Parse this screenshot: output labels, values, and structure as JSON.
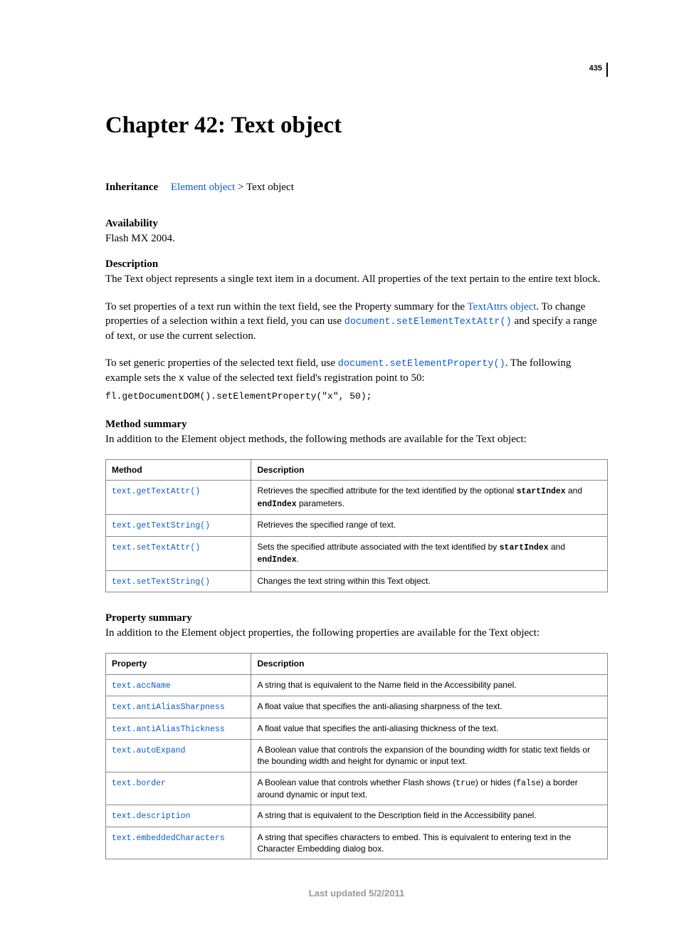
{
  "pageNumber": "435",
  "chapterTitle": "Chapter 42: Text object",
  "inheritance": {
    "label": "Inheritance",
    "link": "Element object",
    "sep": " > ",
    "current": "Text object"
  },
  "availability": {
    "head": "Availability",
    "body": "Flash MX 2004."
  },
  "description": {
    "head": "Description",
    "p1": "The Text object represents a single text item in a document. All properties of the text pertain to the entire text block.",
    "p2a": "To set properties of a text run within the text field, see the Property summary for the ",
    "p2link": "TextAttrs object",
    "p2b": ". To change properties of a selection within a text field, you can use ",
    "p2code": "document.setElementTextAttr()",
    "p2c": " and specify a range of text, or use the current selection.",
    "p3a": "To set generic properties of the selected text field, use ",
    "p3code": "document.setElementProperty()",
    "p3b": ". The following example sets the ",
    "p3x": "x",
    "p3c": " value of the selected text field's registration point to 50:",
    "codeBlock": "fl.getDocumentDOM().setElementProperty(\"x\", 50);"
  },
  "methodSummary": {
    "head": "Method summary",
    "intro": "In addition to the Element object methods, the following methods are available for the Text object:",
    "colMethod": "Method",
    "colDesc": "Description",
    "rows": [
      {
        "name": "text.getTextAttr()",
        "descA": "Retrieves the specified attribute for the text identified by the optional ",
        "c1": "startIndex",
        "descB": " and ",
        "c2": "endIndex",
        "descC": " parameters."
      },
      {
        "name": "text.getTextString()",
        "descA": "Retrieves the specified range of text.",
        "c1": "",
        "descB": "",
        "c2": "",
        "descC": ""
      },
      {
        "name": "text.setTextAttr()",
        "descA": "Sets the specified attribute associated with the text identified by ",
        "c1": "startIndex",
        "descB": " and ",
        "c2": "endIndex",
        "descC": "."
      },
      {
        "name": "text.setTextString()",
        "descA": "Changes the text string within this Text object.",
        "c1": "",
        "descB": "",
        "c2": "",
        "descC": ""
      }
    ]
  },
  "propertySummary": {
    "head": "Property summary",
    "intro": "In addition to the Element object properties, the following properties are available for the Text object:",
    "colProp": "Property",
    "colDesc": "Description",
    "rows": [
      {
        "name": "text.accName",
        "descA": "A string that is equivalent to the Name field in the Accessibility panel.",
        "c1": "",
        "descB": "",
        "c2": "",
        "descC": ""
      },
      {
        "name": "text.antiAliasSharpness",
        "descA": "A float value that specifies the anti-aliasing sharpness of the text.",
        "c1": "",
        "descB": "",
        "c2": "",
        "descC": ""
      },
      {
        "name": "text.antiAliasThickness",
        "descA": "A float value that specifies the anti-aliasing thickness of the text.",
        "c1": "",
        "descB": "",
        "c2": "",
        "descC": ""
      },
      {
        "name": "text.autoExpand",
        "descA": "A Boolean value that controls the expansion of the bounding width for static text fields or the bounding width and height for dynamic or input text.",
        "c1": "",
        "descB": "",
        "c2": "",
        "descC": ""
      },
      {
        "name": "text.border",
        "descA": "A Boolean value that controls whether Flash shows (",
        "c1": "true",
        "descB": ") or hides (",
        "c2": "false",
        "descC": ") a border around dynamic or input text."
      },
      {
        "name": "text.description",
        "descA": "A string that is equivalent to the Description field in the Accessibility panel.",
        "c1": "",
        "descB": "",
        "c2": "",
        "descC": ""
      },
      {
        "name": "text.embeddedCharacters",
        "descA": "A string that specifies characters to embed. This is equivalent to entering text in the Character Embedding dialog box.",
        "c1": "",
        "descB": "",
        "c2": "",
        "descC": ""
      }
    ]
  },
  "footer": "Last updated 5/2/2011"
}
